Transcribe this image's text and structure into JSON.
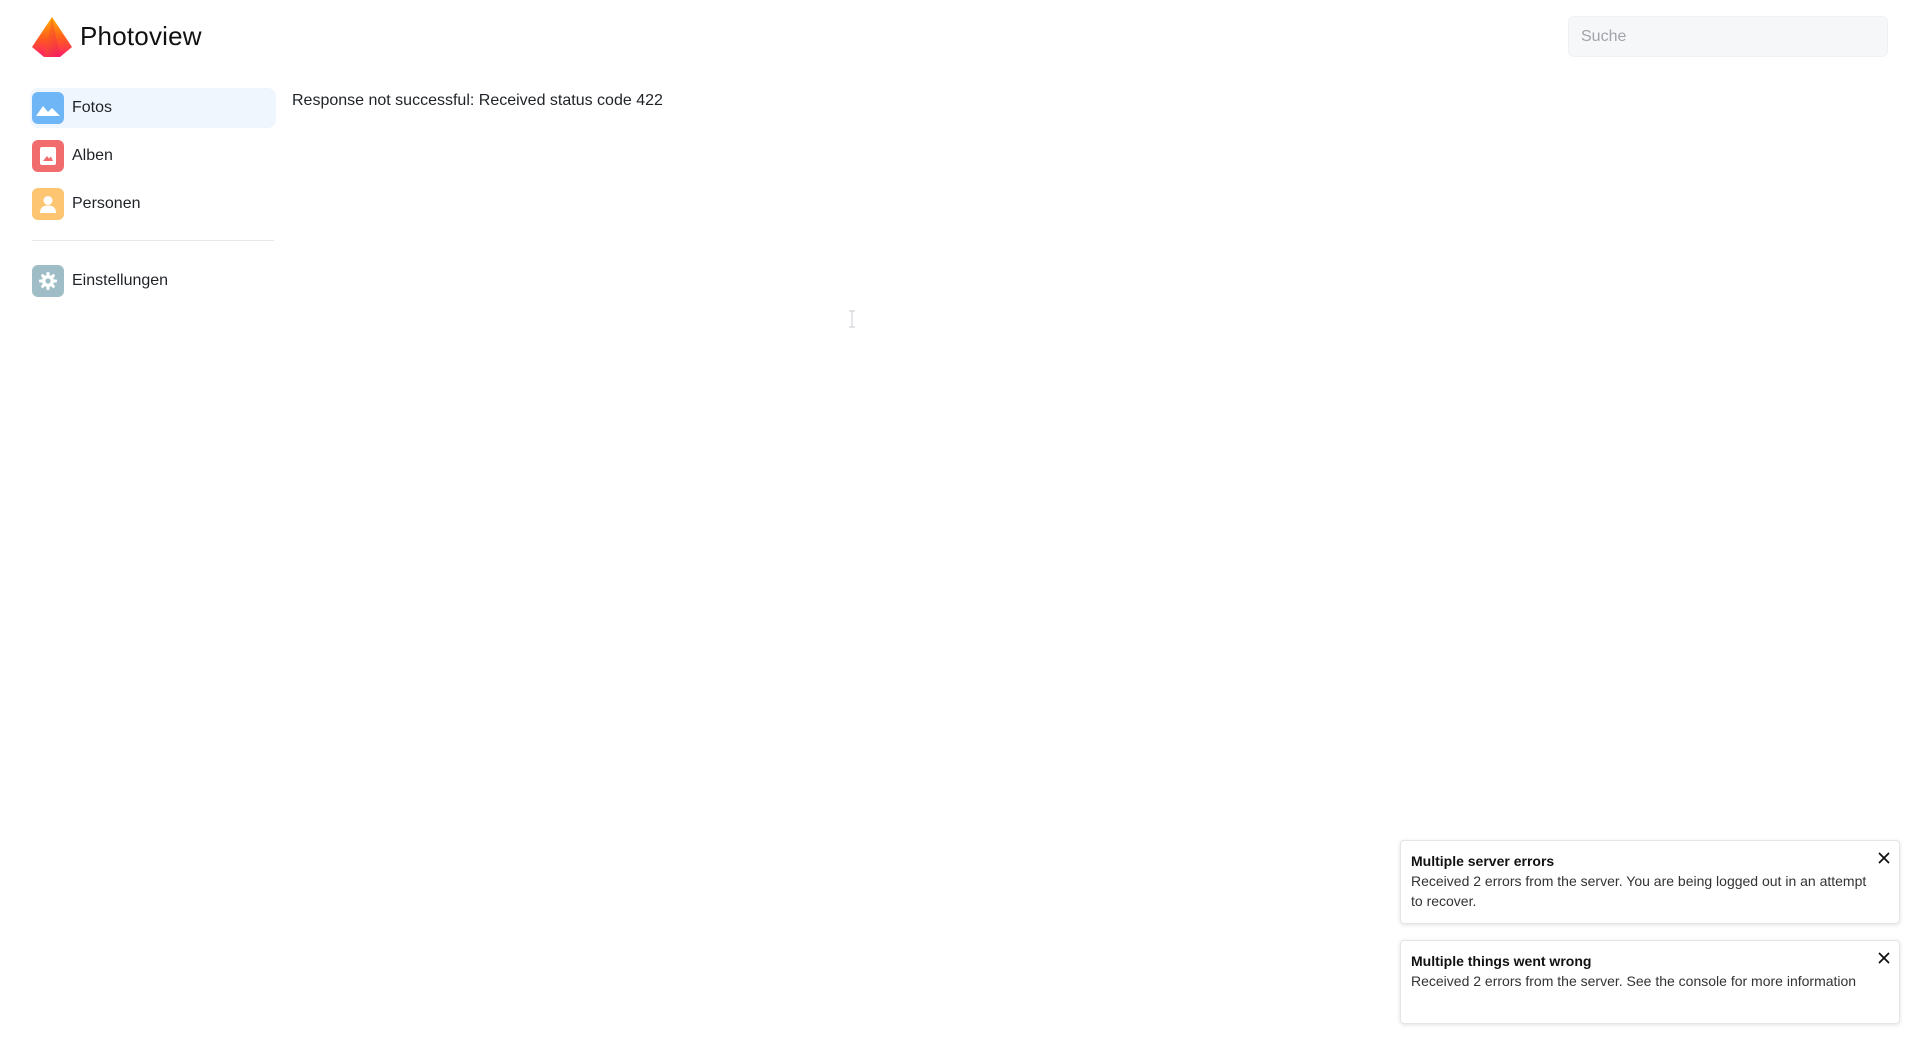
{
  "app": {
    "title": "Photoview"
  },
  "search": {
    "placeholder": "Suche",
    "value": ""
  },
  "sidebar": {
    "items": [
      {
        "label": "Fotos",
        "icon": "photo-icon",
        "color": "#6fb6f6",
        "active": true
      },
      {
        "label": "Alben",
        "icon": "album-icon",
        "color": "#f16d6d",
        "active": false
      },
      {
        "label": "Personen",
        "icon": "person-icon",
        "color": "#fdc571",
        "active": false
      }
    ],
    "settings": {
      "label": "Einstellungen",
      "icon": "gear-icon",
      "color": "#9fbdc6"
    }
  },
  "main": {
    "error_message": "Response not successful: Received status code 422"
  },
  "toasts": [
    {
      "title": "Multiple server errors",
      "body": "Received 2 errors from the server. You are being logged out in an attempt to recover."
    },
    {
      "title": "Multiple things went wrong",
      "body": "Received 2 errors from the server. See the console for more information"
    }
  ]
}
